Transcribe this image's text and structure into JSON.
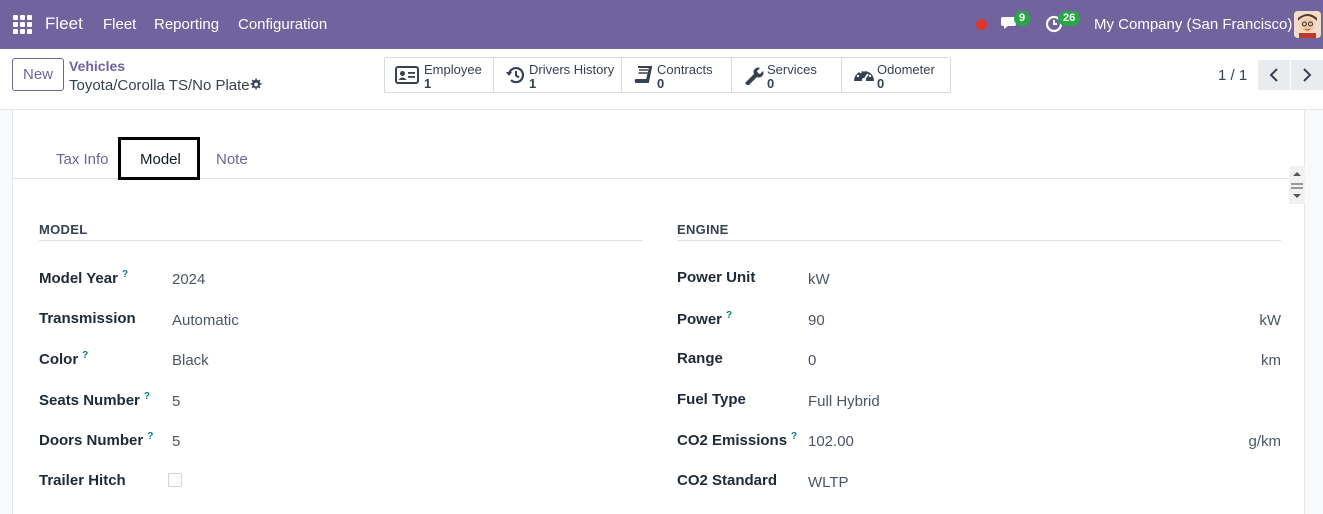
{
  "navbar": {
    "brand": "Fleet",
    "menu": [
      "Fleet",
      "Reporting",
      "Configuration"
    ],
    "messages_count": "9",
    "activities_count": "26",
    "company": "My Company (San Francisco)"
  },
  "control_panel": {
    "new_label": "New",
    "breadcrumb": "Vehicles",
    "record_name": "Toyota/Corolla TS/No Plate",
    "smart_buttons": [
      {
        "label": "Employee",
        "value": "1",
        "icon": "id-card-icon"
      },
      {
        "label": "Drivers History",
        "value": "1",
        "icon": "history-icon"
      },
      {
        "label": "Contracts",
        "value": "0",
        "icon": "book-icon"
      },
      {
        "label": "Services",
        "value": "0",
        "icon": "wrench-icon"
      },
      {
        "label": "Odometer",
        "value": "0",
        "icon": "tachometer-icon"
      }
    ],
    "pager": "1 / 1"
  },
  "tabs": [
    "Tax Info",
    "Model",
    "Note"
  ],
  "active_tab": "Model",
  "model_group": {
    "title": "MODEL",
    "fields": [
      {
        "label": "Model Year",
        "help": "?",
        "value": "2024"
      },
      {
        "label": "Transmission",
        "value": "Automatic"
      },
      {
        "label": "Color",
        "help": "?",
        "value": "Black"
      },
      {
        "label": "Seats Number",
        "help": "?",
        "value": "5"
      },
      {
        "label": "Doors Number",
        "help": "?",
        "value": "5"
      },
      {
        "label": "Trailer Hitch",
        "value": ""
      }
    ]
  },
  "engine_group": {
    "title": "ENGINE",
    "fields": [
      {
        "label": "Power Unit",
        "value": "kW",
        "unit": ""
      },
      {
        "label": "Power",
        "help": "?",
        "value": "90",
        "unit": "kW"
      },
      {
        "label": "Range",
        "value": "0",
        "unit": "km"
      },
      {
        "label": "Fuel Type",
        "value": "Full Hybrid",
        "unit": ""
      },
      {
        "label": "CO2 Emissions",
        "help": "?",
        "value": "102.00",
        "unit": "g/km"
      },
      {
        "label": "CO2 Standard",
        "value": "WLTP",
        "unit": ""
      }
    ]
  },
  "colors": {
    "brand": "#71639e",
    "badge": "#28a745",
    "help": "#017e84",
    "record_dot": "#e0342f"
  }
}
